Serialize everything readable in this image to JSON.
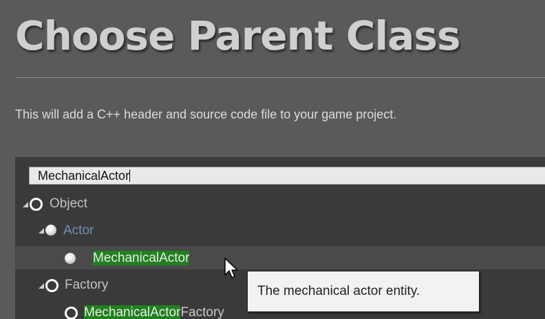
{
  "dialog": {
    "title": "Choose Parent Class",
    "description": "This will add a C++ header and source code file to your game project."
  },
  "search": {
    "value": "MechanicalActor"
  },
  "tree": {
    "object": {
      "label": "Object",
      "icon": "class-ring-icon"
    },
    "actor": {
      "label": "Actor",
      "icon": "actor-sphere-icon",
      "color": "#6f8fb3"
    },
    "mechanical_actor": {
      "match": "MechanicalActor",
      "icon": "actor-sphere-icon"
    },
    "factory": {
      "label": "Factory",
      "icon": "class-ring-icon"
    },
    "mechanical_actor_factory": {
      "match": "MechanicalActor",
      "rest": "Factory",
      "icon": "class-ring-icon"
    }
  },
  "tooltip": {
    "text": "The mechanical actor entity."
  },
  "colors": {
    "background": "#5a5a5a",
    "panel": "#3a3a3a",
    "selected_row": "#4a4a4a",
    "match_highlight": "#21801f",
    "tooltip_bg": "#f2f2f2"
  }
}
